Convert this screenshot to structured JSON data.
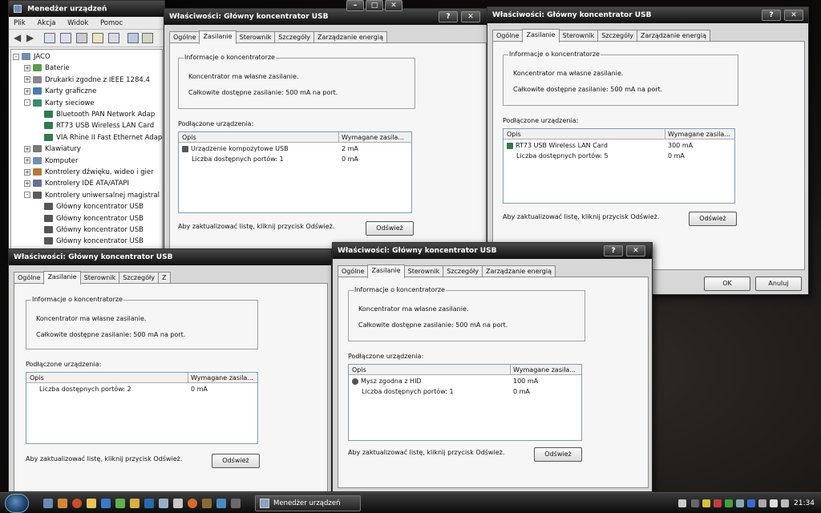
{
  "colors": {
    "titlebar": "#111111",
    "selected_tab": "#f6f6f6",
    "window": "#d7d7d7"
  },
  "device_manager": {
    "title": "Menedżer urządzeń",
    "menu": [
      "Plik",
      "Akcja",
      "Widok",
      "Pomoc"
    ],
    "tree": [
      {
        "label": "JACO",
        "level": 0,
        "expander": "-",
        "icon": "computer-icon"
      },
      {
        "label": "Baterie",
        "level": 1,
        "expander": "+",
        "icon": "battery-icon"
      },
      {
        "label": "Drukarki zgodne z IEEE 1284.4",
        "level": 1,
        "expander": "+",
        "icon": "printer-icon"
      },
      {
        "label": "Karty graficzne",
        "level": 1,
        "expander": "+",
        "icon": "display-adapter-icon"
      },
      {
        "label": "Karty sieciowe",
        "level": 1,
        "expander": "-",
        "icon": "network-adapter-icon"
      },
      {
        "label": "Bluetooth PAN Network Adap",
        "level": 2,
        "expander": "",
        "icon": "network-card-icon"
      },
      {
        "label": "RT73 USB Wireless LAN Card",
        "level": 2,
        "expander": "",
        "icon": "network-card-icon"
      },
      {
        "label": "VIA Rhine II Fast Ethernet Adap",
        "level": 2,
        "expander": "",
        "icon": "network-card-icon"
      },
      {
        "label": "Klawiatury",
        "level": 1,
        "expander": "+",
        "icon": "keyboard-icon"
      },
      {
        "label": "Komputer",
        "level": 1,
        "expander": "+",
        "icon": "computer-icon"
      },
      {
        "label": "Kontrolery dźwięku, wideo i gier",
        "level": 1,
        "expander": "+",
        "icon": "sound-icon"
      },
      {
        "label": "Kontrolery IDE ATA/ATAPI",
        "level": 1,
        "expander": "+",
        "icon": "ide-controller-icon"
      },
      {
        "label": "Kontrolery uniwersalnej magistral",
        "level": 1,
        "expander": "-",
        "icon": "usb-icon"
      },
      {
        "label": "Główny koncentrator USB",
        "level": 2,
        "expander": "",
        "icon": "usb-device-icon"
      },
      {
        "label": "Główny koncentrator USB",
        "level": 2,
        "expander": "",
        "icon": "usb-device-icon"
      },
      {
        "label": "Główny koncentrator USB",
        "level": 2,
        "expander": "",
        "icon": "usb-device-icon"
      },
      {
        "label": "Główny koncentrator USB",
        "level": 2,
        "expander": "",
        "icon": "usb-device-icon"
      }
    ]
  },
  "tabs": [
    "Ogólne",
    "Zasilanie",
    "Sterownik",
    "Szczegóły",
    "Zarządzanie energią"
  ],
  "tabs_truncated": [
    "Ogólne",
    "Zasilanie",
    "Sterownik",
    "Szczegóły",
    "Z"
  ],
  "common": {
    "window_title": "Właściwości: Główny koncentrator USB",
    "help_btn": "?",
    "close_btn": "✕",
    "group_label": "Informacje o koncentratorze",
    "self_powered": "Koncentrator ma własne zasilanie.",
    "total_power": "Całkowite dostępne zasilanie:  500 mA na port.",
    "devices_label": "Podłączone urządzenia:",
    "col_desc": "Opis",
    "col_power": "Wymagane zasila...",
    "refresh_hint": "Aby zaktualizować listę, kliknij przycisk Odśwież.",
    "refresh_btn": "Odśwież",
    "ok_btn": "OK",
    "cancel_btn": "Anuluj"
  },
  "dialogs": {
    "d1": {
      "rows": [
        {
          "desc": "Urządzenie kompozytowe USB",
          "power": "2 mA",
          "icon": "usb-device-icon"
        },
        {
          "desc": "Liczba dostępnych portów: 1",
          "power": "0 mA",
          "icon": ""
        }
      ]
    },
    "d2": {
      "rows": [
        {
          "desc": "RT73 USB Wireless LAN Card",
          "power": "300 mA",
          "icon": "network-card-icon"
        },
        {
          "desc": "Liczba dostępnych portów: 5",
          "power": "0 mA",
          "icon": ""
        }
      ]
    },
    "d3": {
      "rows": [
        {
          "desc": "Liczba dostępnych portów: 2",
          "power": "0 mA",
          "icon": ""
        }
      ]
    },
    "d4": {
      "rows": [
        {
          "desc": "Mysz zgodna z HID",
          "power": "100 mA",
          "icon": "mouse-icon"
        },
        {
          "desc": "Liczba dostępnych portów: 1",
          "power": "0 mA",
          "icon": ""
        }
      ]
    }
  },
  "taskbar": {
    "task_label": "Menedżer urządzeń",
    "clock": "21:34"
  }
}
